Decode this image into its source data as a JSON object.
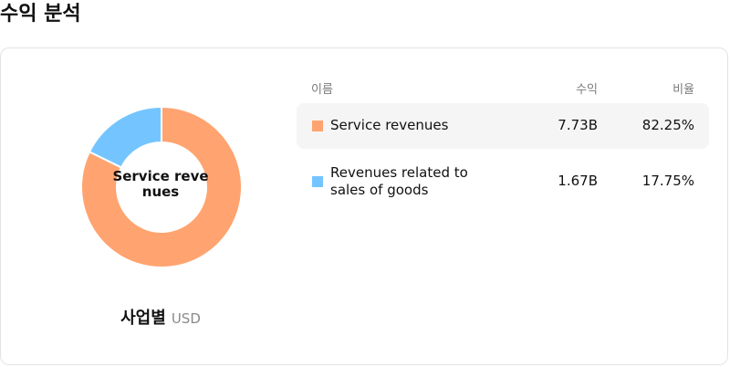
{
  "page": {
    "title": "수익 분석"
  },
  "chart": {
    "center_label": "Service revenues",
    "caption": "사업별",
    "unit": "USD"
  },
  "table": {
    "headers": {
      "name": "이름",
      "revenue": "수익",
      "share": "비율"
    },
    "rows": [
      {
        "name": "Service revenues",
        "revenue": "7.73B",
        "share": "82.25%",
        "color": "#FFA470"
      },
      {
        "name": "Revenues related to sales of goods",
        "revenue": "1.67B",
        "share": "17.75%",
        "color": "#74C5FF"
      }
    ]
  },
  "chart_data": {
    "type": "pie",
    "donut": true,
    "categories": [
      "Service revenues",
      "Revenues related to sales of goods"
    ],
    "values": [
      82.25,
      17.75
    ],
    "colors": [
      "#FFA470",
      "#74C5FF"
    ]
  }
}
